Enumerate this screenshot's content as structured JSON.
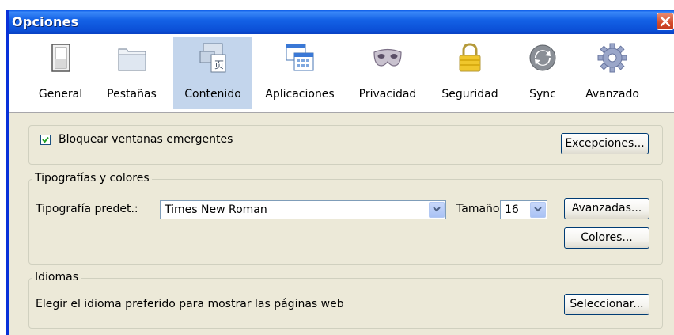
{
  "window": {
    "title": "Opciones"
  },
  "toolbar": {
    "items": [
      {
        "label": "General",
        "icon": "switch-icon"
      },
      {
        "label": "Pestañas",
        "icon": "tabs-icon"
      },
      {
        "label": "Contenido",
        "icon": "content-icon",
        "selected": true
      },
      {
        "label": "Aplicaciones",
        "icon": "applications-icon"
      },
      {
        "label": "Privacidad",
        "icon": "mask-icon"
      },
      {
        "label": "Seguridad",
        "icon": "padlock-icon"
      },
      {
        "label": "Sync",
        "icon": "sync-icon"
      },
      {
        "label": "Avanzado",
        "icon": "gear-icon"
      }
    ]
  },
  "popups": {
    "checkbox_label": "Bloquear ventanas emergentes",
    "checked": true,
    "exceptions_button": "Excepciones..."
  },
  "fonts": {
    "legend": "Tipografías y colores",
    "default_font_label": "Tipografía predet.:",
    "default_font_value": "Times New Roman",
    "size_label": "Tamaño:",
    "size_value": "16",
    "advanced_button": "Avanzadas...",
    "colors_button": "Colores..."
  },
  "languages": {
    "legend": "Idiomas",
    "description": "Elegir el idioma preferido para mostrar las páginas web",
    "select_button": "Seleccionar..."
  },
  "colors": {
    "titlebar": "#0b4fd6",
    "close": "#d34a2a",
    "dialog_bg": "#ece9d8",
    "selected_tab": "#c3d5ec"
  }
}
